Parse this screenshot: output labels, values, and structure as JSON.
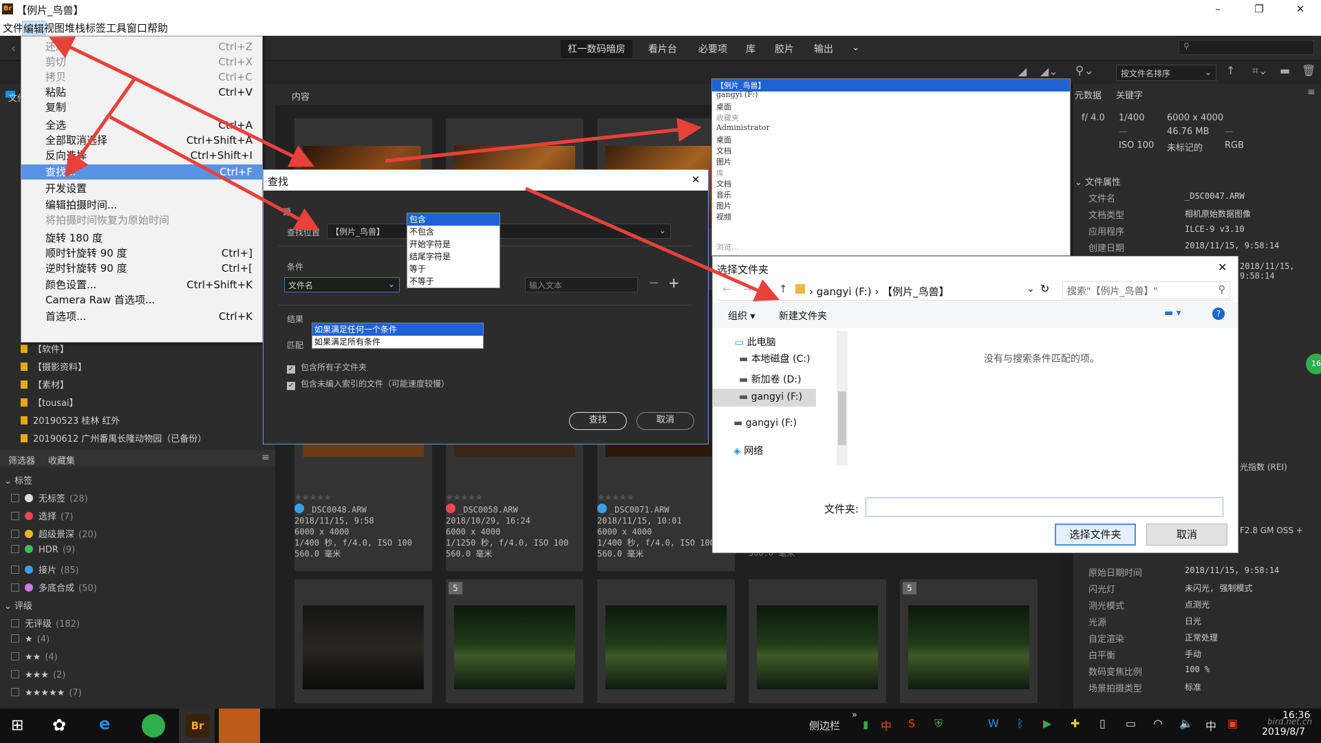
{
  "window": {
    "title": "【例片_鸟兽】",
    "app_icon": "Br",
    "min": "–",
    "restore": "❐",
    "close": "✕"
  },
  "menubar": [
    "文件",
    "编辑",
    "视图",
    "堆栈",
    "标签",
    "工具",
    "窗口",
    "帮助"
  ],
  "workspaces": [
    "杠一数码暗房",
    "看片台",
    "必要项",
    "库",
    "胶片",
    "输出"
  ],
  "sort_label": "按文件名排序",
  "edit_menu": [
    {
      "label": "还原",
      "shortcut": "Ctrl+Z",
      "disabled": true
    },
    {
      "label": "剪切",
      "shortcut": "Ctrl+X",
      "disabled": true
    },
    {
      "label": "拷贝",
      "shortcut": "Ctrl+C",
      "disabled": true
    },
    {
      "label": "粘贴",
      "shortcut": "Ctrl+V"
    },
    {
      "label": "复制",
      "shortcut": ""
    },
    {
      "label": "全选",
      "shortcut": "Ctrl+A"
    },
    {
      "label": "全部取消选择",
      "shortcut": "Ctrl+Shift+A"
    },
    {
      "label": "反向选择",
      "shortcut": "Ctrl+Shift+I"
    },
    {
      "label": "查找...",
      "shortcut": "Ctrl+F",
      "highlighted": true
    },
    {
      "label": "开发设置",
      "shortcut": ""
    },
    {
      "label": "编辑拍摄时间...",
      "shortcut": ""
    },
    {
      "label": "将拍摄时间恢复为原始时间",
      "shortcut": "",
      "disabled": true
    },
    {
      "label": "旋转 180 度",
      "shortcut": ""
    },
    {
      "label": "顺时针旋转 90 度",
      "shortcut": "Ctrl+]"
    },
    {
      "label": "逆时针旋转 90 度",
      "shortcut": "Ctrl+["
    },
    {
      "label": "颜色设置...",
      "shortcut": "Ctrl+Shift+K"
    },
    {
      "label": "Camera Raw 首选项...",
      "shortcut": ""
    },
    {
      "label": "首选项...",
      "shortcut": "Ctrl+K"
    }
  ],
  "left_panel": {
    "tab_files": "文件",
    "folders": [
      "【软件】",
      "【摄影资料】",
      "【素材】",
      "【tousai】",
      "20190523 桂林 红外",
      "20190612 广州番禺长隆动物园（已备份）"
    ],
    "filter_tab": "筛选器",
    "collection_tab": "收藏集",
    "labels_header": "标签",
    "labels": [
      {
        "name": "无标签",
        "count": "(28)",
        "color": "#dddddd"
      },
      {
        "name": "选择",
        "count": "(7)",
        "color": "#e5484d"
      },
      {
        "name": "超级景深",
        "count": "(20)",
        "color": "#f0b429"
      },
      {
        "name": "HDR",
        "count": "(9)",
        "color": "#3fb950"
      },
      {
        "name": "接片",
        "count": "(85)",
        "color": "#3aa0e8"
      },
      {
        "name": "多底合成",
        "count": "(50)",
        "color": "#c87be8"
      }
    ],
    "rating_header": "评级",
    "ratings": [
      {
        "name": "无评级",
        "count": "(182)"
      },
      {
        "name": "★",
        "count": "(4)"
      },
      {
        "name": "★★",
        "count": "(4)"
      },
      {
        "name": "★★★",
        "count": "(2)"
      },
      {
        "name": "★★★★★",
        "count": "(7)"
      }
    ]
  },
  "content": {
    "tab": "内容",
    "items": [
      {
        "file": "_DSC0048.ARW",
        "date": "2018/11/15, 9:58",
        "size": "6000 x 4000",
        "exposure": "1/400 秒, f/4.0, ISO 100",
        "focal": "560.0 毫米",
        "label_color": "#3aa0e8"
      },
      {
        "file": "_DSC0058.ARW",
        "date": "2018/10/29, 16:24",
        "size": "6000 x 4000",
        "exposure": "1/1250 秒, f/4.0, ISO 100",
        "focal": "560.0 毫米",
        "label_color": "#e5484d"
      },
      {
        "file": "_DSC0071.ARW",
        "date": "2018/11/15, 10:01",
        "size": "6000 x 4000",
        "exposure": "1/400 秒, f/4.0, ISO 100",
        "focal": "560.0 毫米",
        "label_color": "#3aa0e8"
      }
    ],
    "stack_badge": "5",
    "partial_focal": "560.0 毫米"
  },
  "find_dialog": {
    "title": "查找",
    "source_label": "源",
    "location_label": "查找位置",
    "location_value": "【例片_鸟兽】",
    "criteria_label": "条件",
    "criteria_field": "文件名",
    "criteria_ops": [
      "包含",
      "不包含",
      "开始字符是",
      "结尾字符是",
      "等于",
      "不等于"
    ],
    "criteria_input_placeholder": "输入文本",
    "results_label": "结果",
    "match_label": "匹配",
    "match_options": [
      "如果满足任何一个条件",
      "如果满足所有条件"
    ],
    "include_subfolders": "包含所有子文件夹",
    "include_unindexed": "包含未编入索引的文件（可能速度较慢）",
    "find_btn": "查找",
    "cancel_btn": "取消",
    "minus": "−",
    "plus": "+"
  },
  "location_dropdown": [
    {
      "text": "【例片_鸟兽】",
      "selected": true
    },
    {
      "text": "gangyi (F:)"
    },
    {
      "text": "桌面"
    },
    {
      "text": "收藏夹",
      "muted": true
    },
    {
      "text": "Administrator"
    },
    {
      "text": "桌面"
    },
    {
      "text": "文档"
    },
    {
      "text": "图片"
    },
    {
      "text": "库",
      "muted": true
    },
    {
      "text": "文档"
    },
    {
      "text": "音乐"
    },
    {
      "text": "图片"
    },
    {
      "text": "视频"
    },
    {
      "text": "浏览...",
      "muted": true
    }
  ],
  "folder_dialog": {
    "title": "选择文件夹",
    "breadcrumb": [
      "gangyi (F:)",
      "【例片_鸟兽】"
    ],
    "search_placeholder": "搜索\"【例片_鸟兽】\"",
    "organize": "组织 ▾",
    "new_folder": "新建文件夹",
    "tree": [
      "此电脑",
      "本地磁盘 (C:)",
      "新加卷 (D:)",
      "gangyi (F:)",
      "gangyi (F:)",
      "网络"
    ],
    "empty_msg": "没有与搜索条件匹配的项。",
    "folder_label": "文件夹:",
    "select_btn": "选择文件夹",
    "cancel_btn": "取消"
  },
  "metadata": {
    "tab_meta": "元数据",
    "tab_keywords": "关键字",
    "aperture": "f/ 4.0",
    "shutter": "1/400",
    "iso": "ISO 100",
    "dims": "6000 x 4000",
    "filesize": "46.76 MB",
    "dash": "—",
    "untagged": "未标记的",
    "colormode": "RGB",
    "section": "文件属性",
    "rows": [
      {
        "k": "文件名",
        "v": "_DSC0047.ARW"
      },
      {
        "k": "文档类型",
        "v": "相机原始数据图像"
      },
      {
        "k": "应用程序",
        "v": "ILCE-9 v3.10"
      },
      {
        "k": "创建日期",
        "v": "2018/11/15, 9:58:14"
      }
    ],
    "partial_date": "2018/11/15, 9:58:14",
    "partial_lens": "F2.8 GM OSS +",
    "partial_rei": "光指数 (REI)",
    "rows2": [
      {
        "k": "原始日期时间",
        "v": "2018/11/15, 9:58:14"
      },
      {
        "k": "闪光灯",
        "v": "未闪光, 强制模式"
      },
      {
        "k": "测光模式",
        "v": "点测光"
      },
      {
        "k": "光源",
        "v": "日光"
      },
      {
        "k": "自定渲染",
        "v": "正常处理"
      },
      {
        "k": "白平衡",
        "v": "手动"
      },
      {
        "k": "数码变焦比例",
        "v": "100 %"
      },
      {
        "k": "场景拍摄类型",
        "v": "标准"
      }
    ]
  },
  "taskbar": {
    "sidebar": "侧边栏",
    "ime": "中",
    "time": "16:36",
    "date": "2019/8/7",
    "watermark": "bird.net.cn"
  },
  "colors": {
    "accent": "#1e62d6",
    "arrow": "#e8413a",
    "highlight": "#5a93e3"
  }
}
